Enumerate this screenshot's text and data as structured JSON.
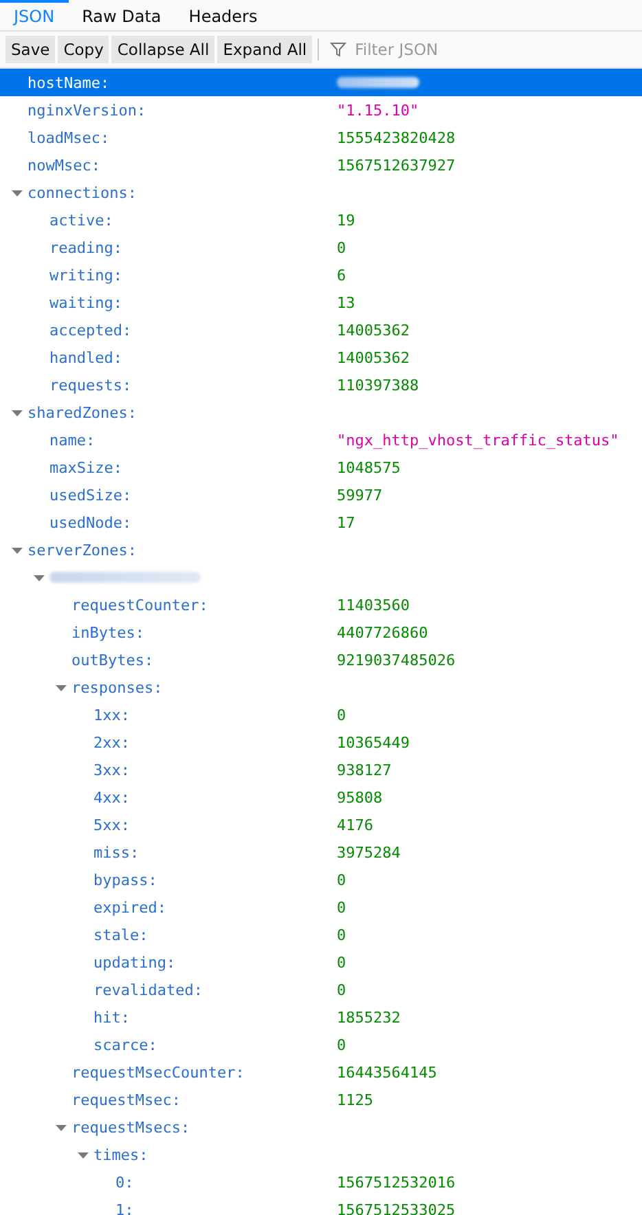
{
  "tabs": [
    {
      "label": "JSON",
      "selected": true
    },
    {
      "label": "Raw Data",
      "selected": false
    },
    {
      "label": "Headers",
      "selected": false
    }
  ],
  "toolbar": {
    "buttons": [
      "Save",
      "Copy",
      "Collapse All",
      "Expand All"
    ],
    "filter": {
      "placeholder": "Filter JSON"
    }
  },
  "tree": [
    {
      "key": "hostName:",
      "kind": "redacted",
      "selected": true
    },
    {
      "key": "nginxVersion:",
      "value": "\"1.15.10\"",
      "kind": "string",
      "selected": false
    },
    {
      "key": "loadMsec:",
      "value": "1555423820428",
      "kind": "number",
      "selected": false
    },
    {
      "key": "nowMsec:",
      "value": "1567512637927",
      "kind": "number",
      "selected": false
    },
    {
      "key": "connections:",
      "expanded": true,
      "selected": false,
      "children": [
        {
          "key": "active:",
          "value": "19",
          "kind": "number",
          "selected": false
        },
        {
          "key": "reading:",
          "value": "0",
          "kind": "number",
          "selected": false
        },
        {
          "key": "writing:",
          "value": "6",
          "kind": "number",
          "selected": false
        },
        {
          "key": "waiting:",
          "value": "13",
          "kind": "number",
          "selected": false
        },
        {
          "key": "accepted:",
          "value": "14005362",
          "kind": "number",
          "selected": false
        },
        {
          "key": "handled:",
          "value": "14005362",
          "kind": "number",
          "selected": false
        },
        {
          "key": "requests:",
          "value": "110397388",
          "kind": "number",
          "selected": false
        }
      ]
    },
    {
      "key": "sharedZones:",
      "expanded": true,
      "selected": false,
      "children": [
        {
          "key": "name:",
          "value": "\"ngx_http_vhost_traffic_status\"",
          "kind": "string",
          "selected": false
        },
        {
          "key": "maxSize:",
          "value": "1048575",
          "kind": "number",
          "selected": false
        },
        {
          "key": "usedSize:",
          "value": "59977",
          "kind": "number",
          "selected": false
        },
        {
          "key": "usedNode:",
          "value": "17",
          "kind": "number",
          "selected": false
        }
      ]
    },
    {
      "key": "serverZones:",
      "expanded": true,
      "selected": false,
      "children": [
        {
          "key_hidden": true,
          "expanded": true,
          "selected": false,
          "children": [
            {
              "key": "requestCounter:",
              "value": "11403560",
              "kind": "number",
              "selected": false
            },
            {
              "key": "inBytes:",
              "value": "4407726860",
              "kind": "number",
              "selected": false
            },
            {
              "key": "outBytes:",
              "value": "9219037485026",
              "kind": "number",
              "selected": false
            },
            {
              "key": "responses:",
              "expanded": true,
              "selected": false,
              "children": [
                {
                  "key": "1xx:",
                  "value": "0",
                  "kind": "number",
                  "selected": false
                },
                {
                  "key": "2xx:",
                  "value": "10365449",
                  "kind": "number",
                  "selected": false
                },
                {
                  "key": "3xx:",
                  "value": "938127",
                  "kind": "number",
                  "selected": false
                },
                {
                  "key": "4xx:",
                  "value": "95808",
                  "kind": "number",
                  "selected": false
                },
                {
                  "key": "5xx:",
                  "value": "4176",
                  "kind": "number",
                  "selected": false
                },
                {
                  "key": "miss:",
                  "value": "3975284",
                  "kind": "number",
                  "selected": false
                },
                {
                  "key": "bypass:",
                  "value": "0",
                  "kind": "number",
                  "selected": false
                },
                {
                  "key": "expired:",
                  "value": "0",
                  "kind": "number",
                  "selected": false
                },
                {
                  "key": "stale:",
                  "value": "0",
                  "kind": "number",
                  "selected": false
                },
                {
                  "key": "updating:",
                  "value": "0",
                  "kind": "number",
                  "selected": false
                },
                {
                  "key": "revalidated:",
                  "value": "0",
                  "kind": "number",
                  "selected": false
                },
                {
                  "key": "hit:",
                  "value": "1855232",
                  "kind": "number",
                  "selected": false
                },
                {
                  "key": "scarce:",
                  "value": "0",
                  "kind": "number",
                  "selected": false
                }
              ]
            },
            {
              "key": "requestMsecCounter:",
              "value": "16443564145",
              "kind": "number",
              "selected": false
            },
            {
              "key": "requestMsec:",
              "value": "1125",
              "kind": "number",
              "selected": false
            },
            {
              "key": "requestMsecs:",
              "expanded": true,
              "selected": false,
              "children": [
                {
                  "key": "times:",
                  "expanded": true,
                  "selected": false,
                  "children": [
                    {
                      "key": "0:",
                      "value": "1567512532016",
                      "kind": "number",
                      "selected": false
                    },
                    {
                      "key": "1:",
                      "value": "1567512533025",
                      "kind": "number",
                      "selected": false
                    }
                  ]
                }
              ]
            }
          ]
        }
      ]
    }
  ]
}
